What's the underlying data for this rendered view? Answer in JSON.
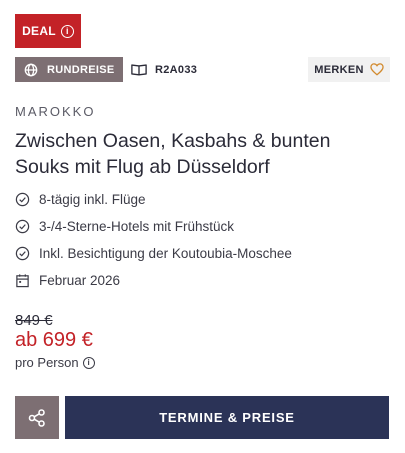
{
  "badge": {
    "label": "DEAL",
    "info_glyph": "i",
    "color": "#c32227"
  },
  "tags": {
    "type_label": "RUNDREISE",
    "type_icon": "globe-icon",
    "code": "R2A033",
    "code_icon": "book-open-icon",
    "save_label": "MERKEN",
    "save_icon": "heart-outline-icon"
  },
  "offer": {
    "country": "MAROKKO",
    "title": "Zwischen Oasen, Kasbahs & bunten Souks mit Flug ab Düsseldorf",
    "features": [
      {
        "icon": "check-circle-icon",
        "text": "8-tägig inkl. Flüge"
      },
      {
        "icon": "check-circle-icon",
        "text": "3-/4-Sterne-Hotels mit Frühstück"
      },
      {
        "icon": "check-circle-icon",
        "text": "Inkl. Besichtigung der Koutoubia-Moschee"
      },
      {
        "icon": "calendar-icon",
        "text": "Februar 2026"
      }
    ]
  },
  "price": {
    "old": "849 €",
    "new": "ab 699 €",
    "per_person": "pro Person",
    "accent_color": "#c32227"
  },
  "actions": {
    "share_icon": "share-icon",
    "cta_label": "TERMINE & PREISE",
    "cta_color": "#2b3357"
  }
}
